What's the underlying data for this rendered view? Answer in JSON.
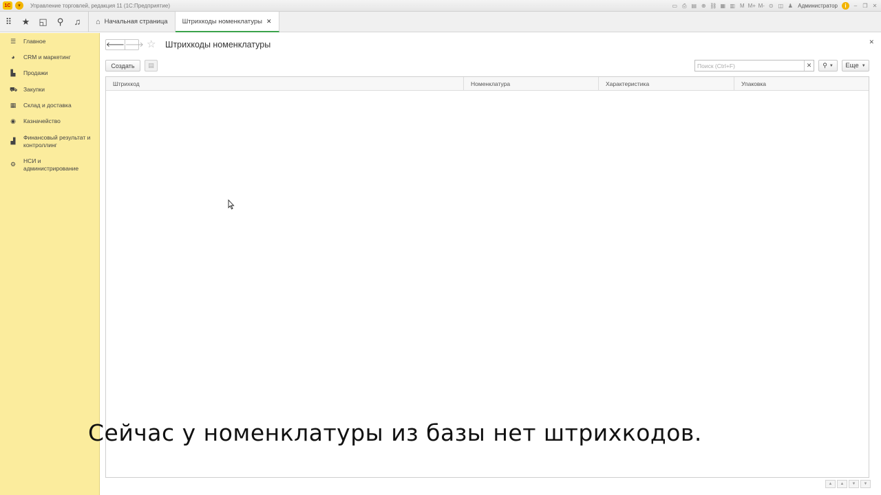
{
  "titlebar": {
    "logo_text": "1С",
    "app_title": "Управление торговлей, редакция 11  (1С:Предприятие)",
    "user": "Администратор",
    "icons": [
      "save-icon",
      "print-icon",
      "view-icon",
      "add-icon",
      "link-icon",
      "calendar-icon",
      "calc-icon",
      "m-icon",
      "m-plus-icon",
      "m-minus-icon",
      "zoom-icon",
      "panel-icon",
      "user-icon",
      "info-icon",
      "minimize-icon",
      "restore-icon",
      "close-icon"
    ],
    "m_label": "M",
    "mplus_label": "M+",
    "mminus_label": "M-"
  },
  "toppanel": {
    "tabs": [
      {
        "label": "Начальная страница",
        "active": false
      },
      {
        "label": "Штрихкоды номенклатуры",
        "active": true
      }
    ]
  },
  "sidebar": {
    "items": [
      {
        "label": "Главное",
        "icon": "menu-icon"
      },
      {
        "label": "CRM и маркетинг",
        "icon": "pie-icon"
      },
      {
        "label": "Продажи",
        "icon": "bag-icon"
      },
      {
        "label": "Закупки",
        "icon": "cart-icon"
      },
      {
        "label": "Склад и доставка",
        "icon": "warehouse-icon"
      },
      {
        "label": "Казначейство",
        "icon": "money-icon"
      },
      {
        "label": "Финансовый результат и контроллинг",
        "icon": "chart-icon"
      },
      {
        "label": "НСИ и администрирование",
        "icon": "gear-icon"
      }
    ]
  },
  "form": {
    "title": "Штрихкоды номенклатуры",
    "create_label": "Создать",
    "search_placeholder": "Поиск (Ctrl+F)",
    "more_label": "Еще",
    "columns": [
      "Штрихкод",
      "Номенклатура",
      "Характеристика",
      "Упаковка"
    ]
  },
  "caption": "Сейчас у номенклатуры из базы нет штрихкодов."
}
